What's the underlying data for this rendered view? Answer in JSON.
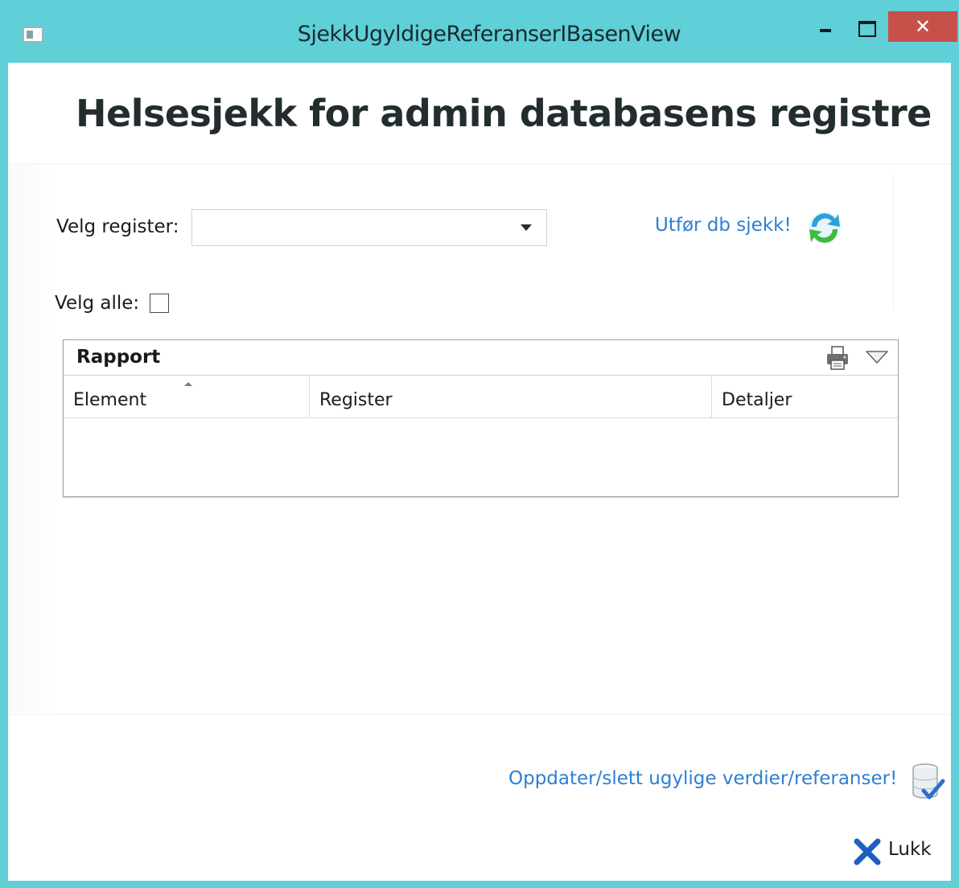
{
  "window": {
    "title": "SjekkUgyldigeReferanserIBasenView",
    "close_glyph": "✕"
  },
  "header": {
    "title": "Helsesjekk for admin databasens registre"
  },
  "form": {
    "register_label": "Velg register:",
    "register_value": "",
    "select_all_label": "Velg alle:",
    "select_all_checked": false,
    "run_check_link": "Utfør db sjekk!"
  },
  "report": {
    "title": "Rapport",
    "columns": [
      "Element",
      "Register",
      "Detaljer"
    ],
    "rows": []
  },
  "footer": {
    "update_link": "Oppdater/slett ugylige verdier/referanser!",
    "close_label": "Lukk"
  },
  "icons": {
    "app": "window-app-icon",
    "refresh": "refresh-icon",
    "print": "printer-icon",
    "menu": "chevron-down-icon",
    "update": "database-check-icon",
    "close": "close-x-icon"
  },
  "colors": {
    "frame": "#5fcfd8",
    "link": "#2d7fd2",
    "close_button": "#c7504b",
    "close_x": "#1f5fbf"
  }
}
